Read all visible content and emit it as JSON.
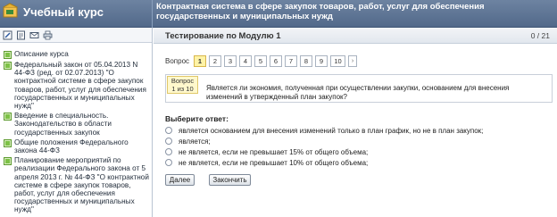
{
  "header": {
    "app_title": "Учебный курс",
    "course_title": "Контрактная система в сфере закупок товаров, работ, услуг для обеспечения государственных и муниципальных нужд"
  },
  "sidebar": {
    "toolbar": [
      {
        "icon": "edit-icon"
      },
      {
        "icon": "notes-icon"
      },
      {
        "icon": "mail-icon"
      },
      {
        "icon": "print-icon"
      }
    ],
    "items": [
      {
        "label": "Описание курса"
      },
      {
        "label": "Федеральный закон от 05.04.2013 N 44-ФЗ (ред. от 02.07.2013) \"О контрактной системе в сфере закупок товаров, работ, услуг для обеспечения государственных и муниципальных нужд\""
      },
      {
        "label": "Введение в специальность. Законодательство в области государственных закупок"
      },
      {
        "label": "Общие положения Федерального закона 44-ФЗ"
      },
      {
        "label": "Планирование мероприятий по реализации Федерального закона от 5 апреля 2013 г. № 44-ФЗ \"О контрактной системе в сфере закупок товаров, работ, услуг для обеспечения государственных и муниципальных нужд\""
      }
    ]
  },
  "main": {
    "title": "Тестирование по Модулю 1",
    "progress": "0 / 21",
    "question_nav": {
      "label": "Вопрос",
      "buttons": [
        "1",
        "2",
        "3",
        "4",
        "5",
        "6",
        "7",
        "8",
        "9",
        "10"
      ],
      "current": "1",
      "next_symbol": "›"
    },
    "question": {
      "number_line1": "Вопрос",
      "number_line2": "1 из 10",
      "text": "Является ли экономия, полученная при осуществлении закупки, основанием для внесения изменений в утвержденный план закупок?"
    },
    "answers_heading": "Выберите ответ:",
    "answers": [
      "является основанием для внесения изменений только в план график, но не в план закупок;",
      "является;",
      "не является, если не превышает 15% от общего объема;",
      "не является, если не превышает 10% от общего объема;"
    ],
    "buttons": {
      "next": "Далее",
      "finish": "Закончить"
    }
  },
  "colors": {
    "header_bg": "#5f7696",
    "current_question_bg": "#fff3a6",
    "question_number_bg": "#fff8cc"
  }
}
